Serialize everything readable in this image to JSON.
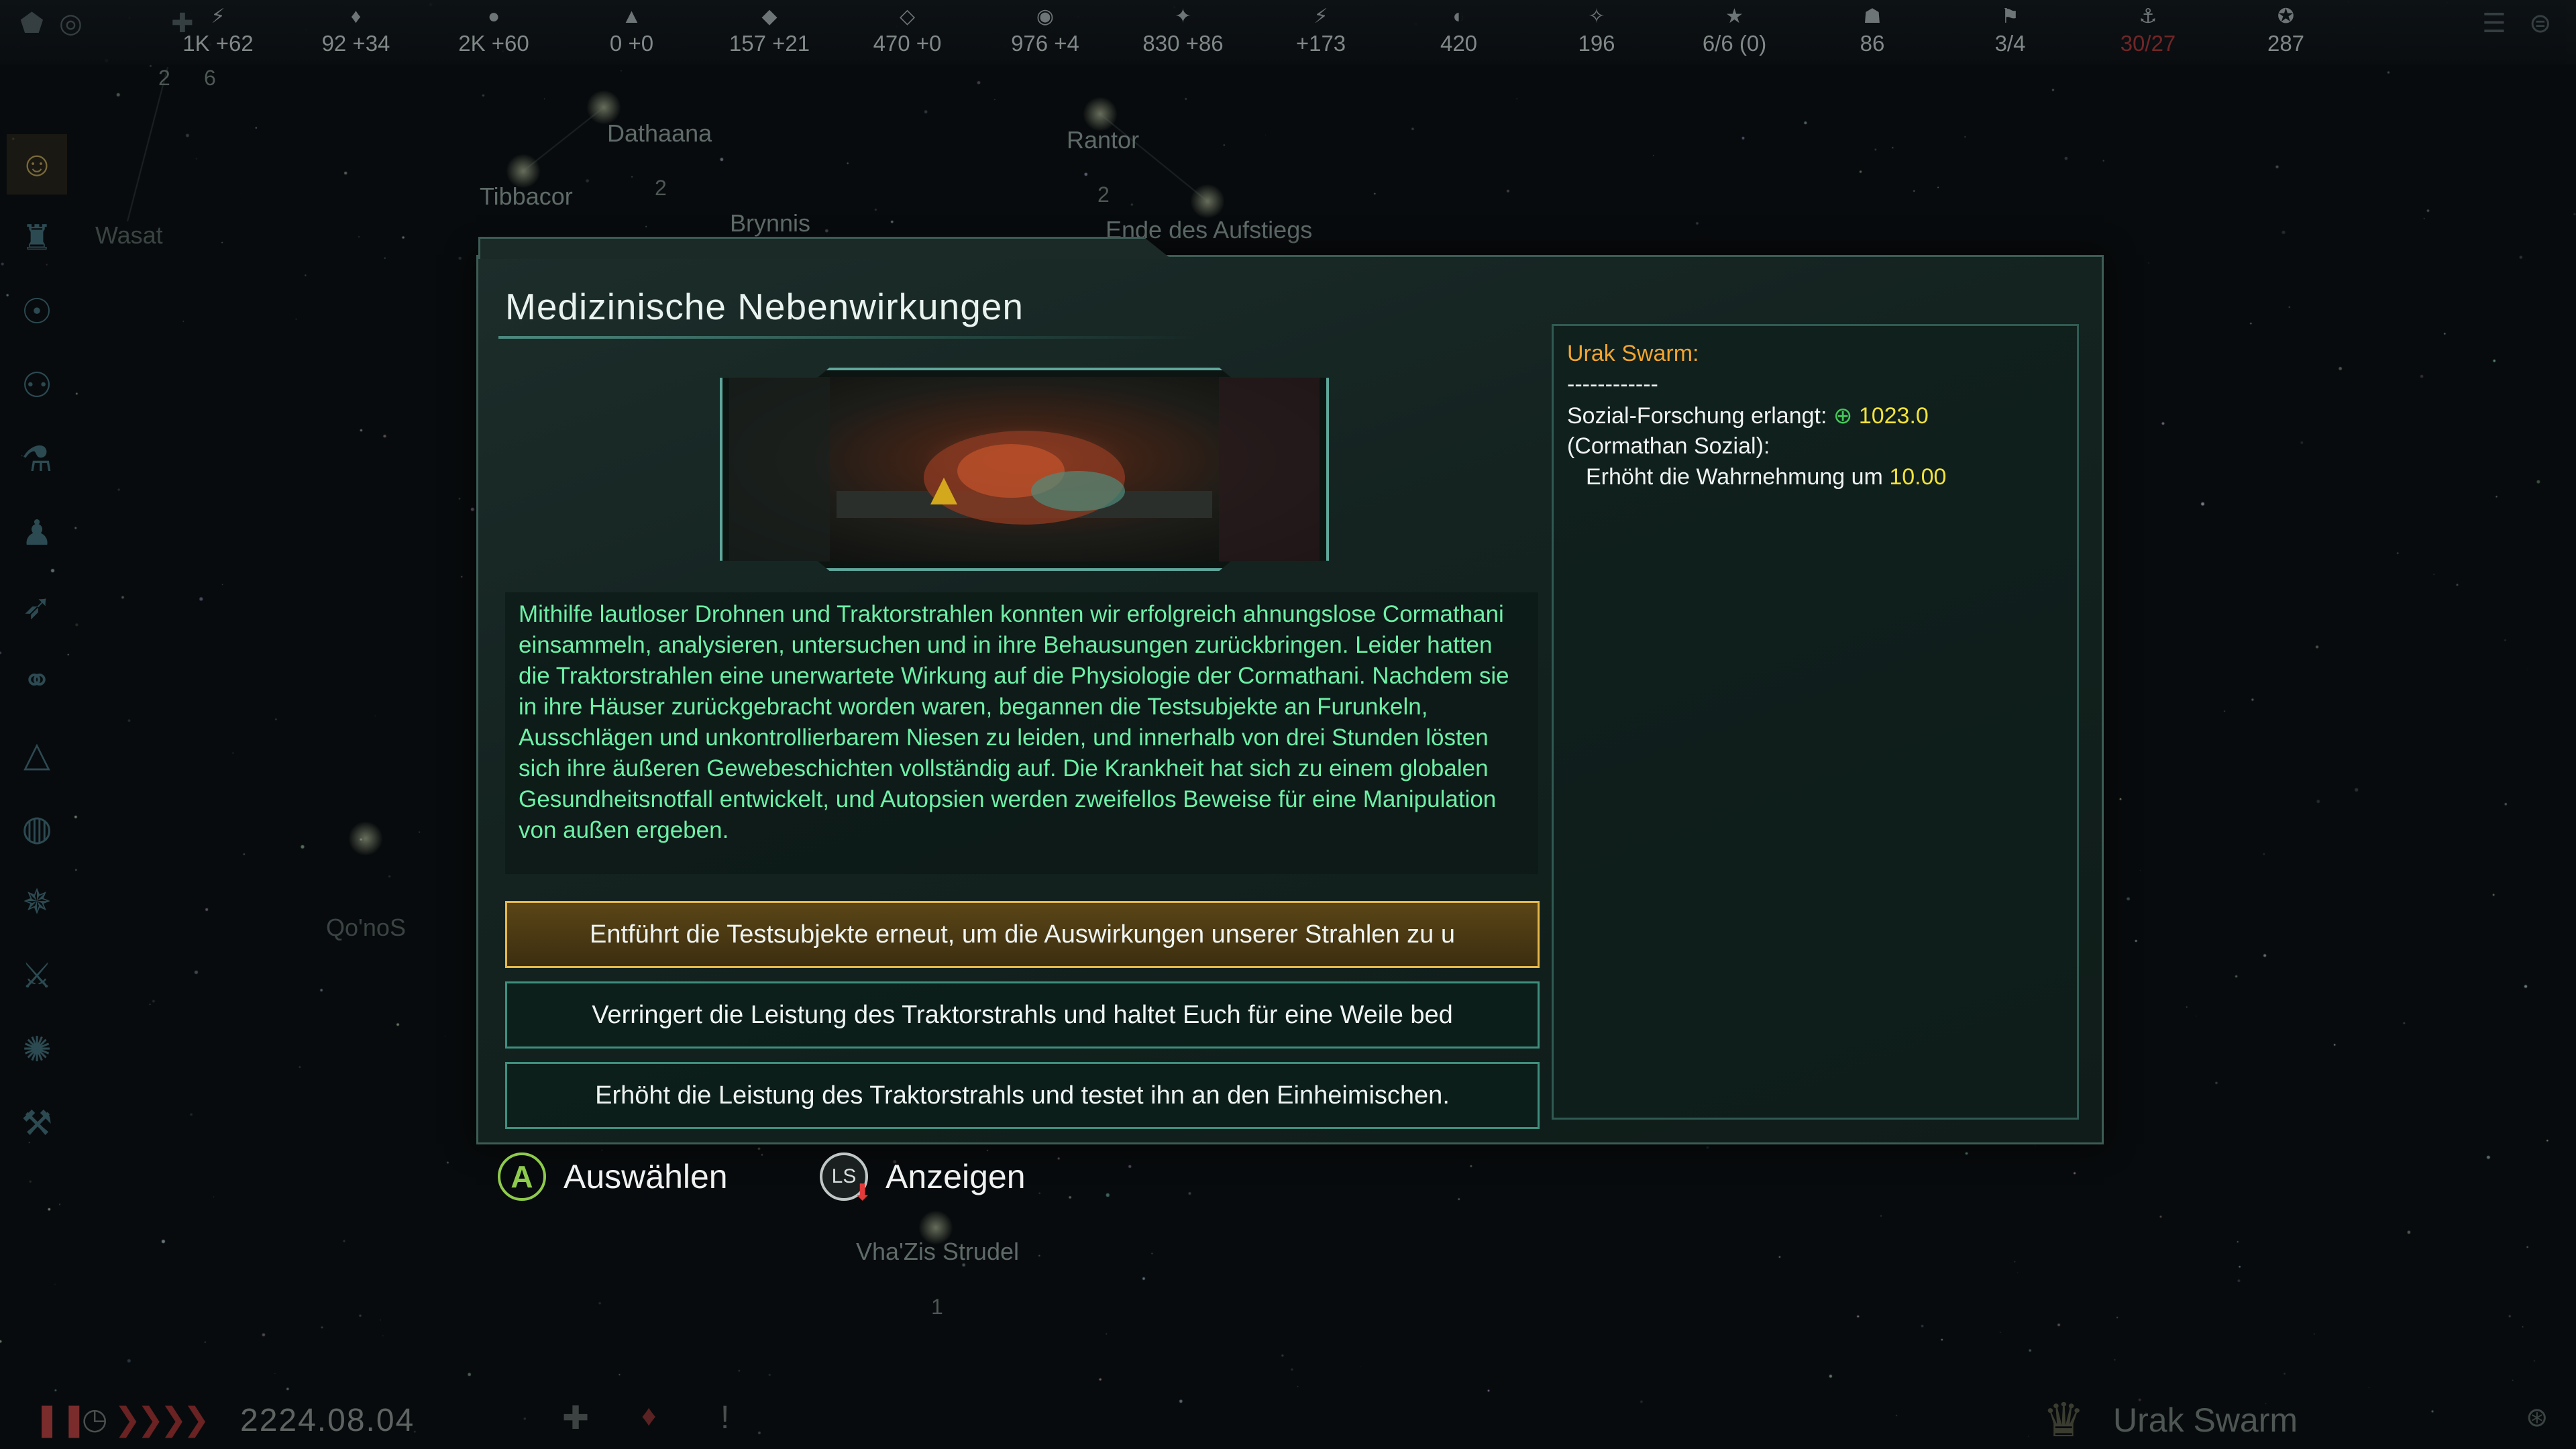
{
  "resources": [
    {
      "icon": "energy-icon",
      "glyph": "⚡",
      "value": "1K +62"
    },
    {
      "icon": "minerals-icon",
      "glyph": "♦",
      "value": "92 +34"
    },
    {
      "icon": "food-icon",
      "glyph": "●",
      "value": "2K +60"
    },
    {
      "icon": "consumer-goods-icon",
      "glyph": "▲",
      "value": "0 +0"
    },
    {
      "icon": "alloys-icon",
      "glyph": "◆",
      "value": "157 +21"
    },
    {
      "icon": "strategic-icon",
      "glyph": "◇",
      "value": "470 +0"
    },
    {
      "icon": "influence-icon",
      "glyph": "◉",
      "value": "976 +4"
    },
    {
      "icon": "unity-icon",
      "glyph": "✦",
      "value": "830 +86"
    },
    {
      "icon": "research-icon",
      "glyph": "⚡",
      "value": "+173"
    },
    {
      "icon": "amenities-icon",
      "glyph": "◐",
      "value": "420"
    },
    {
      "icon": "stability-icon",
      "glyph": "✧",
      "value": "196"
    },
    {
      "icon": "pops-icon",
      "glyph": "★",
      "value": "6/6 (0)"
    },
    {
      "icon": "envoys-icon",
      "glyph": "☗",
      "value": "86"
    },
    {
      "icon": "starbases-icon",
      "glyph": "⚑",
      "value": "3/4"
    },
    {
      "icon": "naval-cap-icon",
      "glyph": "⚓",
      "value": "30/27"
    },
    {
      "icon": "fleet-icon",
      "glyph": "✪",
      "value": "287"
    }
  ],
  "map": {
    "labels": {
      "dathaana": "Dathaana",
      "tibbacor": "Tibbacor",
      "brynnis": "Brynnis",
      "rantor": "Rantor",
      "ende": "Ende des Aufstiegs",
      "wasat": "Wasat",
      "qonos": "Qo'noS",
      "vhazis": "Vha'Zis Strudel"
    },
    "numbers": {
      "n1": "2",
      "n2": "6",
      "n3": "2",
      "n4": "2",
      "n5": "1"
    }
  },
  "dialog": {
    "title": "Medizinische Nebenwirkungen",
    "description": "Mithilfe lautloser Drohnen und Traktorstrahlen konnten wir erfolgreich ahnungslose Cormathani einsammeln, analysieren, untersuchen und in ihre Behausungen zurückbringen. Leider hatten die Traktorstrahlen eine unerwartete Wirkung auf die Physiologie der Cormathani. Nachdem sie in ihre Häuser zurückgebracht worden waren, begannen die Testsubjekte an Furunkeln, Ausschlägen und unkontrollierbarem Niesen zu leiden, und innerhalb von drei Stunden lösten sich ihre äußeren Gewebeschichten vollständig auf. Die Krankheit hat sich zu einem globalen Gesundheitsnotfall entwickelt, und Autopsien werden zweifellos Beweise für eine Manipulation von außen ergeben.",
    "options": [
      "Entführt die Testsubjekte erneut, um die Auswirkungen unserer Strahlen zu u",
      "Verringert die Leistung des Traktorstrahls und haltet Euch für eine Weile bed",
      "Erhöht die Leistung des Traktorstrahls und testet ihn an den Einheimischen."
    ],
    "effects": {
      "empire": "Urak Swarm:",
      "separator": "------------",
      "research_label": "Sozial-Forschung erlangt:",
      "research_value": "1023.0",
      "target": "(Cormathan Sozial):",
      "perception_label": "Erhöht die Wahrnehmung um",
      "perception_value": "10.00"
    }
  },
  "hints": {
    "select_key": "A",
    "select_label": "Auswählen",
    "view_key": "LS",
    "view_label": "Anzeigen"
  },
  "bottom": {
    "date": "2224.08.04",
    "empire_name": "Urak Swarm"
  },
  "colors": {
    "description_text": "#6ef0a7",
    "empire_name": "#f2a531",
    "highlight_value": "#f2e23a",
    "selected_border": "#e6b84a"
  }
}
